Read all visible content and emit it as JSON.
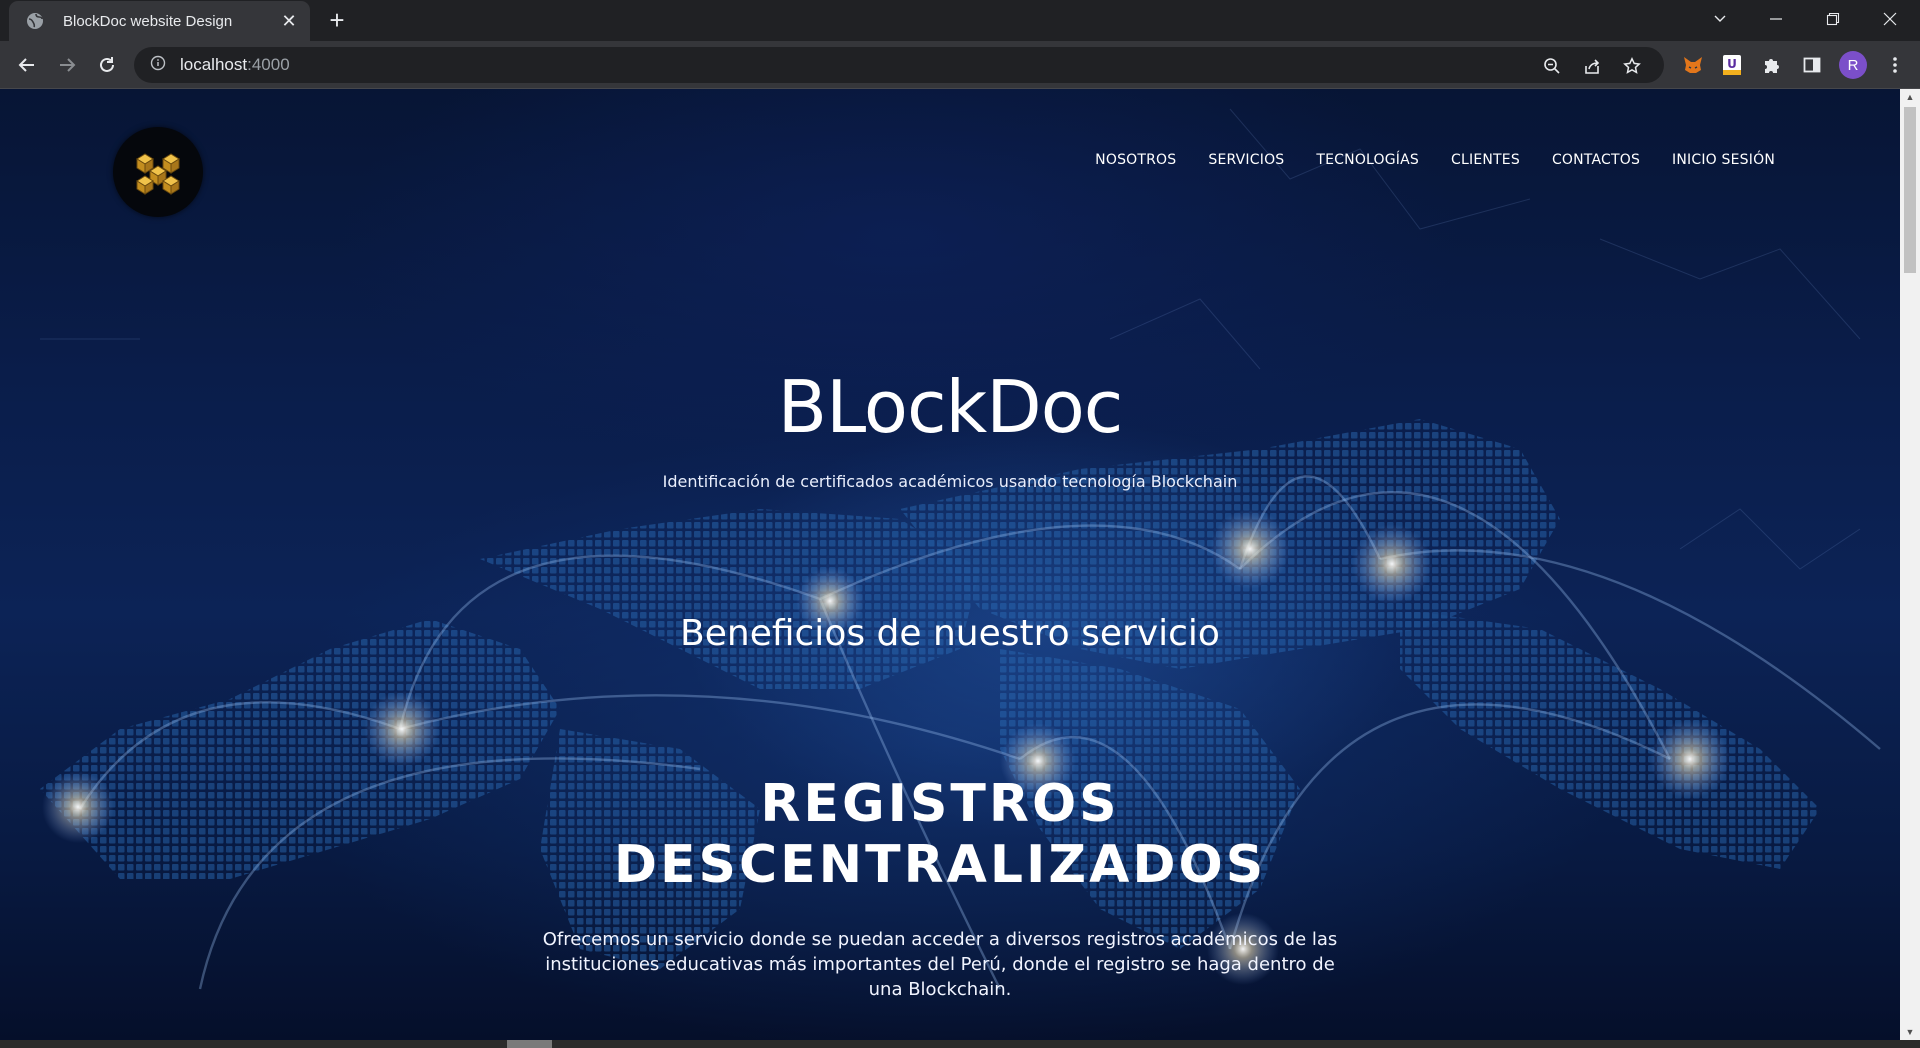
{
  "browser": {
    "tab_title": "BlockDoc website Design",
    "tab_close": "✕",
    "new_tab": "+",
    "url_host": "localhost",
    "url_port": ":4000",
    "profile_initial": "R",
    "ext_u_letter": "U"
  },
  "site": {
    "nav": [
      "NOSOTROS",
      "SERVICIOS",
      "TECNOLOGÍAS",
      "CLIENTES",
      "CONTACTOS",
      "INICIO SESIÓN"
    ],
    "hero_title": "BLockDoc",
    "hero_subtitle": "Identificación de certificados académicos usando tecnología Blockchain",
    "benefits_title": "Beneficios de nuestro servicio",
    "feature_title_line1": "REGISTROS",
    "feature_title_line2": "DESCENTRALIZADOS",
    "feature_description": "Ofrecemos un servicio donde se puedan acceder a diversos registros académicos de las instituciones educativas más importantes del Perú, donde el registro se haga dentro de una Blockchain."
  },
  "colors": {
    "accent_gold": "#d9a42b",
    "page_bg": "#0a1d4a",
    "profile": "#7b4fc9"
  },
  "icons": [
    "globe-icon",
    "close-icon",
    "plus-icon",
    "chevron-down-icon",
    "minimize-icon",
    "restore-icon",
    "back-arrow-icon",
    "forward-arrow-icon",
    "reload-icon",
    "info-icon",
    "zoom-icon",
    "share-icon",
    "star-icon",
    "fox-extension-icon",
    "u-extension-icon",
    "puzzle-icon",
    "sidepanel-icon",
    "menu-dots-icon",
    "blocks-logo-icon"
  ]
}
